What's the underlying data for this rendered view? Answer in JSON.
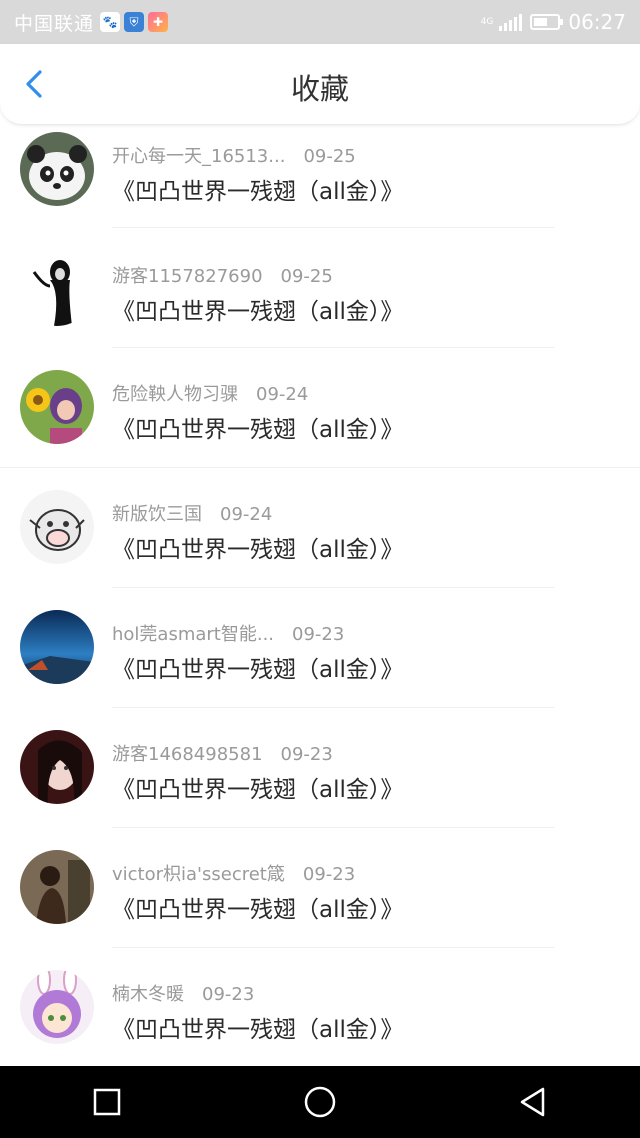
{
  "status": {
    "carrier": "中国联通",
    "apps": [
      "baidu-icon",
      "shield-icon",
      "plus-icon"
    ],
    "net": "4G",
    "time": "06:27",
    "battery_level": 0.6
  },
  "header": {
    "title": "收藏"
  },
  "items": [
    {
      "user": "开心每一天_16513...",
      "date": "09-25",
      "title": "《凹凸世界一残翅（all金）》"
    },
    {
      "user": "游客1157827690",
      "date": "09-25",
      "title": "《凹凸世界一残翅（all金）》"
    },
    {
      "user": "危险鞅人物习骒",
      "date": "09-24",
      "title": "《凹凸世界一残翅（all金）》"
    },
    {
      "user": "新版饮三国",
      "date": "09-24",
      "title": "《凹凸世界一残翅（all金）》"
    },
    {
      "user": "hol莞asmart智能...",
      "date": "09-23",
      "title": "《凹凸世界一残翅（all金）》"
    },
    {
      "user": "游客1468498581",
      "date": "09-23",
      "title": "《凹凸世界一残翅（all金）》"
    },
    {
      "user": "victor枳ia'ssecret箴",
      "date": "09-23",
      "title": "《凹凸世界一残翅（all金）》"
    },
    {
      "user": "楠木冬暖",
      "date": "09-23",
      "title": "《凹凸世界一残翅（all金）》"
    }
  ],
  "colors": {
    "accent": "#2f8ef0",
    "statusbar": "#d9d9d9",
    "navbar": "#000000"
  }
}
